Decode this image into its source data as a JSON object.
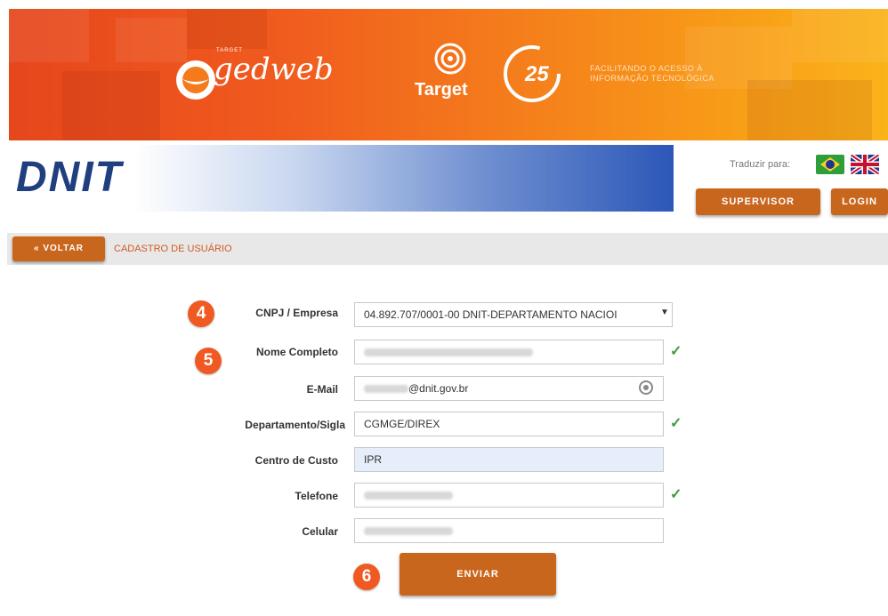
{
  "banner": {
    "gedweb_small": "TARGET",
    "gedweb_text": "gedweb",
    "target_text": "Target",
    "anniversary_text": "25",
    "tagline_line1": "FACILITANDO O ACESSO À",
    "tagline_line2": "INFORMAÇÃO TECNOLÓGICA"
  },
  "header": {
    "logo": "DNIT",
    "translate_label": "Traduzir para:",
    "supervisor_label": "SUPERVISOR",
    "login_label": "LOGIN"
  },
  "breadcrumb": {
    "back_label": "« VOLTAR",
    "current": "CADASTRO DE USUÁRIO"
  },
  "form": {
    "fields": [
      {
        "label": "CNPJ / Empresa",
        "value": "04.892.707/0001-00 DNIT-DEPARTAMENTO NACIOI"
      },
      {
        "label": "Nome Completo",
        "value": ""
      },
      {
        "label": "E-Mail",
        "value": "@dnit.gov.br"
      },
      {
        "label": "Departamento/Sigla",
        "value": "CGMGE/DIREX"
      },
      {
        "label": "Centro de Custo",
        "value": "IPR"
      },
      {
        "label": "Telefone",
        "value": ""
      },
      {
        "label": "Celular",
        "value": ""
      }
    ],
    "submit_label": "ENVIAR"
  },
  "steps": [
    "4",
    "5",
    "6"
  ],
  "colors": {
    "accent": "#c9661e",
    "step": "#f05a22",
    "brand_blue": "#1f3f7f",
    "valid": "#3d9a3d"
  }
}
